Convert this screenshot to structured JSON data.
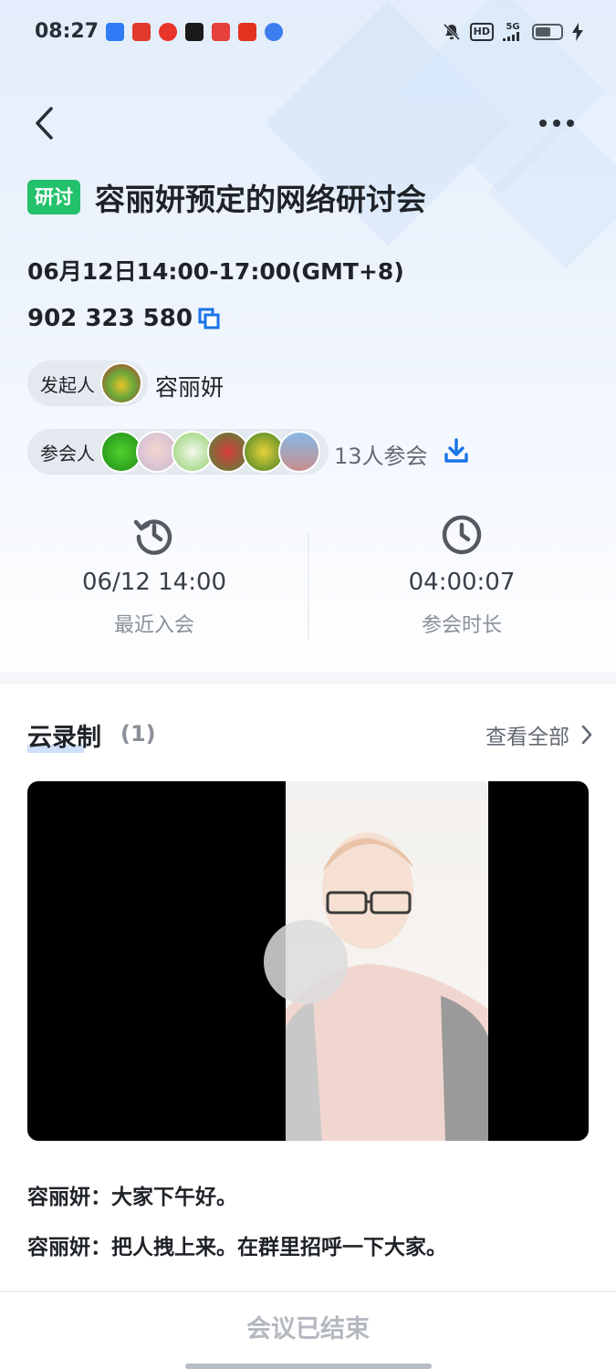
{
  "status_bar": {
    "time": "08:27",
    "network": "5G",
    "hd": "HD",
    "app_icons": [
      {
        "name": "feishu-icon",
        "color": "#2f7bf6"
      },
      {
        "name": "jd-icon",
        "color": "#e23a2a"
      },
      {
        "name": "video-app-icon",
        "color": "#e8352b"
      },
      {
        "name": "douyin-icon",
        "color": "#1a1a1a"
      },
      {
        "name": "toutiao-icon",
        "color": "#e5403b"
      },
      {
        "name": "pinduoduo-icon",
        "color": "#e2331e"
      },
      {
        "name": "tencent-video-icon",
        "color": "#3c7ef0"
      }
    ]
  },
  "meeting": {
    "tag": "研讨",
    "title": "容丽妍预定的网络研讨会",
    "time_range": "06月12日14:00-17:00(GMT+8)",
    "id": "902 323 580",
    "organizer_label": "发起人",
    "organizer_name": "容丽妍",
    "attendee_label": "参会人",
    "attendee_count": "13人参会"
  },
  "stats": {
    "last_join_value": "06/12 14:00",
    "last_join_label": "最近入会",
    "duration_value": "04:00:07",
    "duration_label": "参会时长"
  },
  "recording": {
    "title": "云录制",
    "count": "(1)",
    "view_all": "查看全部"
  },
  "transcript": [
    {
      "speaker": "容丽妍：",
      "text": "大家下午好。"
    },
    {
      "speaker": "容丽妍：",
      "text": "把人拽上来。在群里招呼一下大家。"
    }
  ],
  "footer": {
    "status": "会议已结束"
  },
  "colors": {
    "accent": "#1a73e8",
    "tag_green": "#23c16b"
  }
}
